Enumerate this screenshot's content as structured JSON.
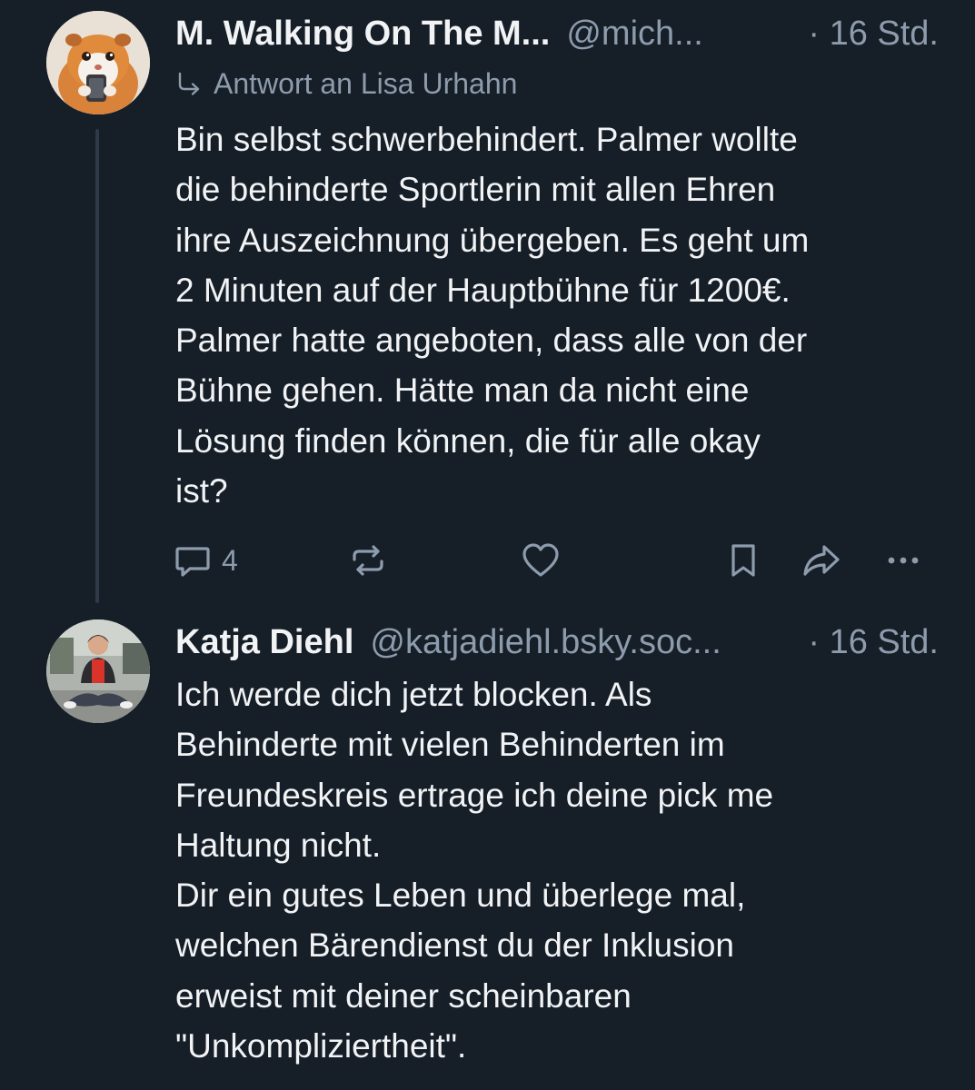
{
  "posts": [
    {
      "display_name": "M. Walking On The M...",
      "handle": "@mich...",
      "time": "· 16 Std.",
      "reply_to": "Antwort an Lisa Urhahn",
      "text": "Bin selbst schwerbehindert. Palmer wollte\ndie behinderte Sportlerin mit allen Ehren\nihre Auszeichnung übergeben. Es geht um\n2 Minuten auf der Hauptbühne für 1200€.\nPalmer hatte angeboten, dass alle von der\nBühne gehen. Hätte man da nicht eine\nLösung finden können, die für alle okay\nist?",
      "actions": {
        "reply_count": "4",
        "icons": [
          "reply-icon",
          "repost-icon",
          "like-icon",
          "bookmark-icon",
          "share-icon",
          "more-icon"
        ]
      }
    },
    {
      "display_name": "Katja Diehl",
      "handle": "@katjadiehl.bsky.soc...",
      "time": "· 16 Std.",
      "text": "Ich werde dich jetzt blocken. Als\nBehinderte mit vielen Behinderten im\nFreundeskreis ertrage ich deine pick me\nHaltung nicht.\nDir ein gutes Leben und überlege mal,\nwelchen Bärendienst du der Inklusion\nerweist mit deiner scheinbaren\n\"Unkompliziertheit\"."
    }
  ],
  "colors": {
    "background": "#161e27",
    "text_primary": "#f1f3f5",
    "text_secondary": "#8d9cad",
    "thread_line": "#2e3a47"
  }
}
